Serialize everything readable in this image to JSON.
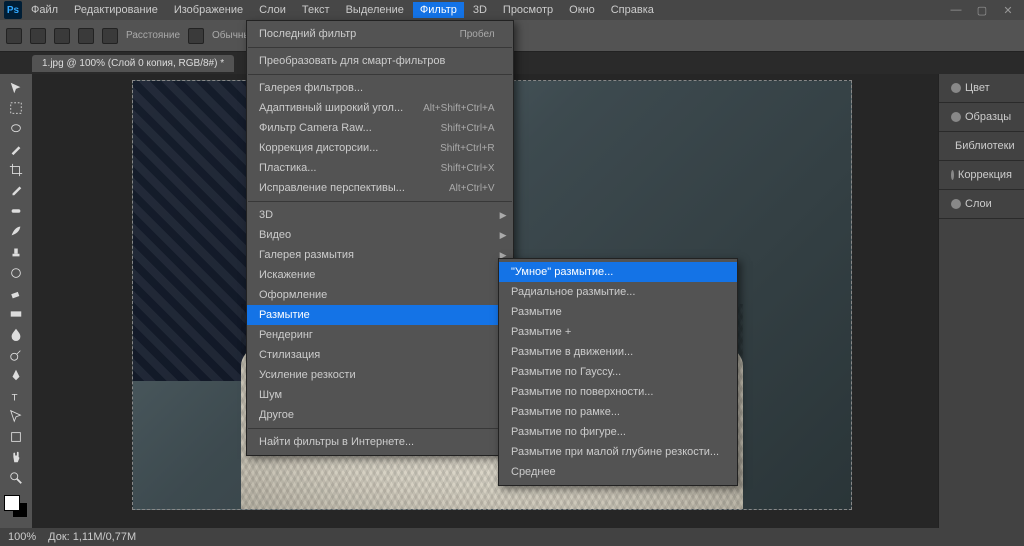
{
  "menubar": {
    "items": [
      "Файл",
      "Редактирование",
      "Изображение",
      "Слои",
      "Текст",
      "Выделение",
      "Фильтр",
      "3D",
      "Просмотр",
      "Окно",
      "Справка"
    ],
    "active_index": 6
  },
  "window_controls": {
    "min": "—",
    "max": "▢",
    "close": "✕"
  },
  "optionbar": {
    "labels": [
      "Расстояние",
      "",
      "",
      "Обычные"
    ]
  },
  "tab": {
    "title": "1.jpg @ 100% (Слой 0 копия, RGB/8#) *"
  },
  "filter_menu": {
    "last_filter": {
      "label": "Последний фильтр",
      "shortcut": "Пробел",
      "disabled": true
    },
    "smart": {
      "label": "Преобразовать для смарт-фильтров"
    },
    "gallery": {
      "label": "Галерея фильтров..."
    },
    "adaptive": {
      "label": "Адаптивный широкий угол...",
      "shortcut": "Alt+Shift+Ctrl+A"
    },
    "camera_raw": {
      "label": "Фильтр Camera Raw...",
      "shortcut": "Shift+Ctrl+A"
    },
    "lens": {
      "label": "Коррекция дисторсии...",
      "shortcut": "Shift+Ctrl+R"
    },
    "liquify": {
      "label": "Пластика...",
      "shortcut": "Shift+Ctrl+X"
    },
    "vanish": {
      "label": "Исправление перспективы...",
      "shortcut": "Alt+Ctrl+V"
    },
    "submenus": [
      {
        "label": "3D",
        "disabled": true
      },
      {
        "label": "Видео"
      },
      {
        "label": "Галерея размытия"
      },
      {
        "label": "Искажение"
      },
      {
        "label": "Оформление"
      },
      {
        "label": "Размытие",
        "selected": true
      },
      {
        "label": "Рендеринг"
      },
      {
        "label": "Стилизация"
      },
      {
        "label": "Усиление резкости"
      },
      {
        "label": "Шум"
      },
      {
        "label": "Другое"
      }
    ],
    "browse": {
      "label": "Найти фильтры в Интернете..."
    }
  },
  "blur_submenu": {
    "items": [
      {
        "label": "\"Умное\" размытие...",
        "selected": true
      },
      {
        "label": "Радиальное размытие..."
      },
      {
        "label": "Размытие"
      },
      {
        "label": "Размытие +"
      },
      {
        "label": "Размытие в движении..."
      },
      {
        "label": "Размытие по Гауссу..."
      },
      {
        "label": "Размытие по поверхности..."
      },
      {
        "label": "Размытие по рамке..."
      },
      {
        "label": "Размытие по фигуре..."
      },
      {
        "label": "Размытие при малой глубине резкости..."
      },
      {
        "label": "Среднее"
      }
    ]
  },
  "right_panels": {
    "items": [
      "Цвет",
      "Образцы",
      "Библиотеки",
      "Коррекция",
      "Слои"
    ]
  },
  "statusbar": {
    "zoom": "100%",
    "doc": "Док: 1,11М/0,77М"
  }
}
